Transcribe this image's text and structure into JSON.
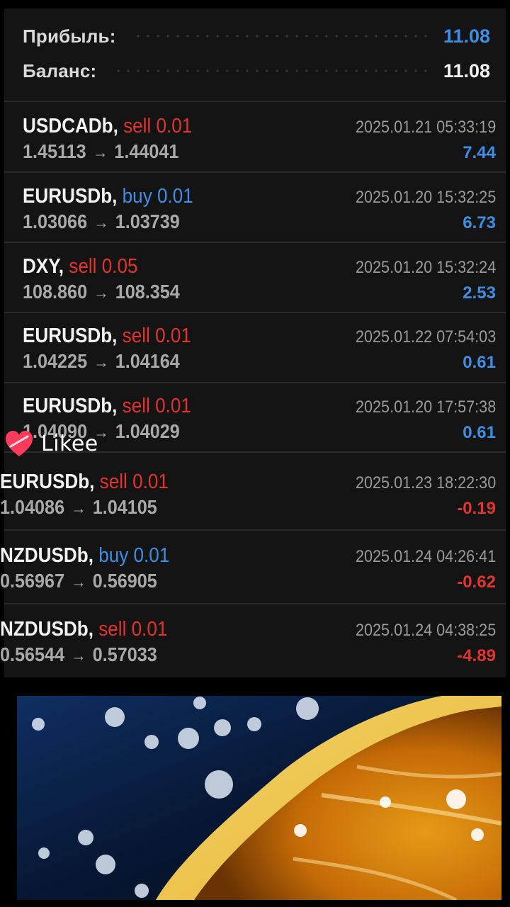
{
  "summary": {
    "profit_label": "Прибыль:",
    "profit_value": "11.08",
    "balance_label": "Баланс:",
    "balance_value": "11.08",
    "profit_color": "#3d8fe6",
    "balance_color": "#f2f2f2"
  },
  "trades": [
    {
      "symbol": "USDCADb,",
      "type": "sell 0.01",
      "side": "sell",
      "open": "1.45113",
      "close": "1.44041",
      "time": "2025.01.21 05:33:19",
      "profit": "7.44"
    },
    {
      "symbol": "EURUSDb,",
      "type": "buy 0.01",
      "side": "buy",
      "open": "1.03066",
      "close": "1.03739",
      "time": "2025.01.20 15:32:25",
      "profit": "6.73"
    },
    {
      "symbol": "DXY,",
      "type": "sell 0.05",
      "side": "sell",
      "open": "108.860",
      "close": "108.354",
      "time": "2025.01.20 15:32:24",
      "profit": "2.53"
    },
    {
      "symbol": "EURUSDb,",
      "type": "sell 0.01",
      "side": "sell",
      "open": "1.04225",
      "close": "1.04164",
      "time": "2025.01.22 07:54:03",
      "profit": "0.61"
    },
    {
      "symbol": "EURUSDb,",
      "type": "sell 0.01",
      "side": "sell",
      "open": "1.04090",
      "close": "1.04029",
      "time": "2025.01.20 17:57:38",
      "profit": "0.61"
    },
    {
      "symbol": "EURUSDb,",
      "type": "sell 0.01",
      "side": "sell",
      "open": "1.04086",
      "close": "1.04105",
      "time": "2025.01.23 18:22:30",
      "profit": "-0.19"
    },
    {
      "symbol": "NZDUSDb,",
      "type": "buy 0.01",
      "side": "buy",
      "open": "0.56967",
      "close": "0.56905",
      "time": "2025.01.24 04:26:41",
      "profit": "-0.62"
    },
    {
      "symbol": "NZDUSDb,",
      "type": "sell 0.01",
      "side": "sell",
      "open": "0.56544",
      "close": "0.57033",
      "time": "2025.01.24 04:38:25",
      "profit": "-4.89"
    }
  ],
  "arrow": "→",
  "watermark": {
    "text": "Likee",
    "icon": "heart-logo-icon",
    "color": "#ff3b5c"
  },
  "colors": {
    "sell": "#e2332d",
    "buy": "#3d8fe6",
    "positive_profit": "#3d8fe6",
    "negative_profit": "#e2332d"
  }
}
